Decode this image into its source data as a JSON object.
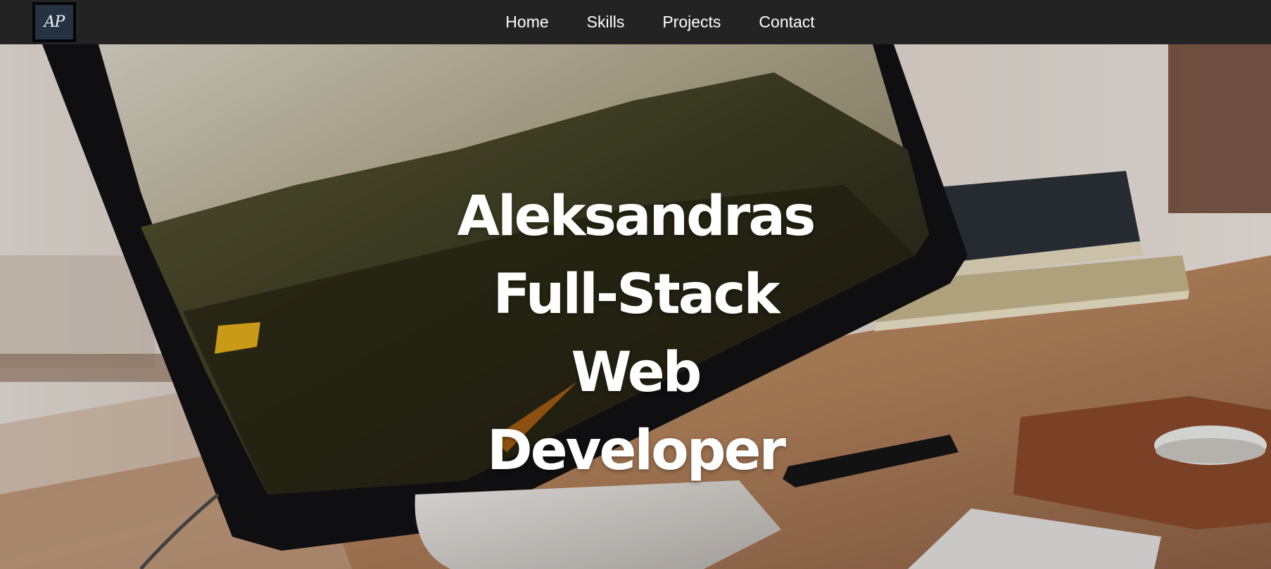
{
  "logo": {
    "text": "AP"
  },
  "nav": {
    "items": [
      {
        "label": "Home"
      },
      {
        "label": "Skills"
      },
      {
        "label": "Projects"
      },
      {
        "label": "Contact"
      }
    ]
  },
  "hero": {
    "lines": [
      "Aleksandras",
      "Full-Stack",
      "Web",
      "Developer"
    ]
  },
  "colors": {
    "navbar": "#232323",
    "logo_bg": "#243241",
    "text": "#ffffff"
  }
}
